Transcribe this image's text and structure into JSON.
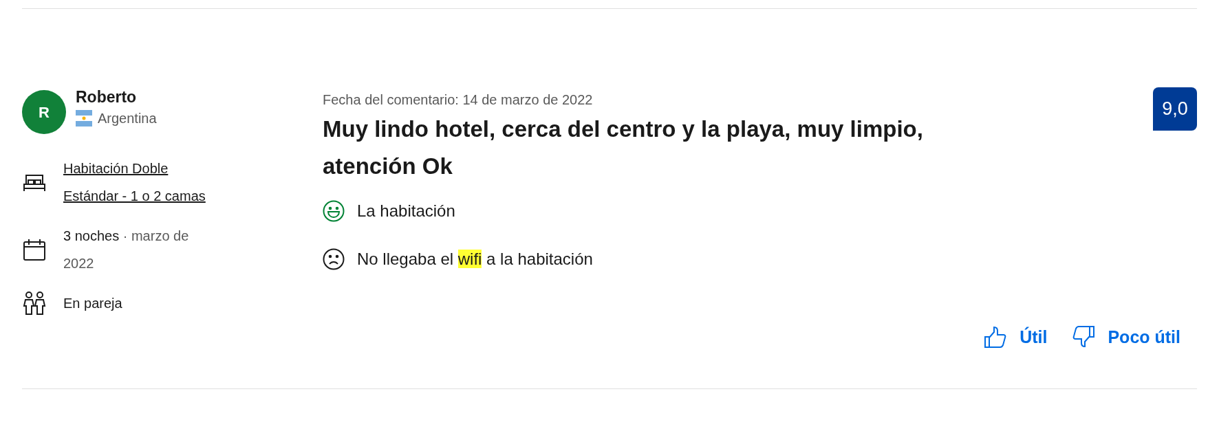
{
  "reviewer": {
    "initial": "R",
    "name": "Roberto",
    "country": "Argentina"
  },
  "stay": [
    {
      "kind": "room",
      "text": "Habitación Doble Estándar - 1 o 2 camas"
    },
    {
      "kind": "dates",
      "text": "3 noches",
      "detail": "· marzo de 2022"
    },
    {
      "kind": "group",
      "text": "En pareja"
    }
  ],
  "review": {
    "date": "Fecha del comentario: 14 de marzo de 2022",
    "title": "Muy lindo hotel, cerca del centro y la playa, muy limpio, atención Ok",
    "comments": [
      {
        "kind": "positive",
        "parts": [
          {
            "text": "La habitación",
            "highlighted": false
          }
        ]
      },
      {
        "kind": "negative",
        "parts": [
          {
            "text": "No llegaba el ",
            "highlighted": false
          },
          {
            "text": "wifi",
            "highlighted": true
          },
          {
            "text": " a la habitación",
            "highlighted": false
          }
        ]
      }
    ]
  },
  "score": "9,0",
  "actions": [
    {
      "kind": "helpful",
      "label": "Útil"
    },
    {
      "kind": "not_helpful",
      "label": "Poco útil"
    }
  ]
}
